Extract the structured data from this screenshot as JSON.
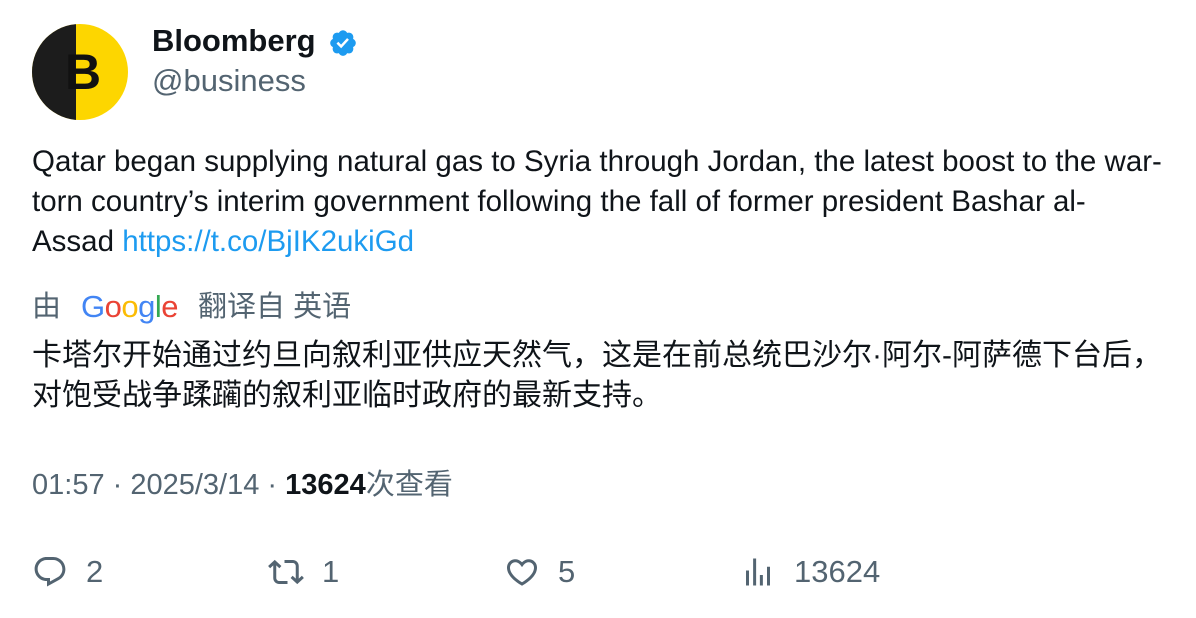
{
  "author": {
    "name": "Bloomberg",
    "handle": "@business",
    "avatar_letter": "B",
    "verified_icon": "verified-badge-icon"
  },
  "tweet": {
    "text": "Qatar began supplying natural gas to Syria through Jordan, the latest boost to the war-torn country’s interim government following the fall of former president Bashar al-Assad ",
    "link": "https://t.co/BjIK2ukiGd"
  },
  "translation": {
    "prefix": "由",
    "provider": "Google",
    "suffix": "翻译自 英语",
    "text": "卡塔尔开始通过约旦向叙利亚供应天然气，这是在前总统巴沙尔·阿尔-阿萨德下台后，对饱受战争蹂躏的叙利亚临时政府的最新支持。"
  },
  "meta": {
    "time": "01:57",
    "date": "2025/3/14",
    "separator": " · ",
    "views_count": "13624",
    "views_label": "次查看"
  },
  "actions": {
    "replies": "2",
    "retweets": "1",
    "likes": "5",
    "views": "13624"
  },
  "colors": {
    "link": "#1d9bf0",
    "secondary_text": "#536471",
    "avatar_yellow": "#fdd600",
    "verified_blue": "#1d9bf0"
  }
}
